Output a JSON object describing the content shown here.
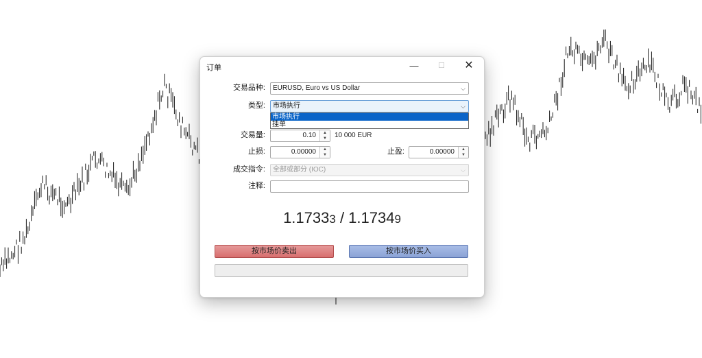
{
  "dialog": {
    "title": "订单",
    "min_glyph": "—",
    "max_glyph": "☐",
    "close_glyph": "✕",
    "symbol": {
      "label": "交易品种:",
      "value": "EURUSD, Euro vs US Dollar"
    },
    "type": {
      "label": "类型:",
      "value": "市场执行",
      "options": [
        "市场执行",
        "挂单"
      ],
      "selected_index": 0
    },
    "volume": {
      "label": "交易量:",
      "value": "0.10",
      "note": "10 000 EUR"
    },
    "stop_loss": {
      "label": "止损:",
      "value": "0.00000"
    },
    "take_profit": {
      "label": "止盈:",
      "value": "0.00000"
    },
    "fill_policy": {
      "label": "成交指令:",
      "value": "全部或部分 (IOC)",
      "enabled": false
    },
    "comment": {
      "label": "注释:",
      "value": ""
    },
    "quote": {
      "bid_main": "1.1733",
      "bid_small": "3",
      "separator": " / ",
      "ask_main": "1.1734",
      "ask_small": "9"
    },
    "sell_button": "按市场价卖出",
    "buy_button": "按市场价买入",
    "progress": 0
  },
  "icons": {
    "chevron": "chevron-down-icon",
    "spin_up": "▲",
    "spin_down": "▼",
    "chevron_glyph": "⌵"
  },
  "colors": {
    "sell": "#d86e6e",
    "buy": "#8ba3d6",
    "selected": "#0a64c8",
    "chart": "#1a1a1a"
  }
}
